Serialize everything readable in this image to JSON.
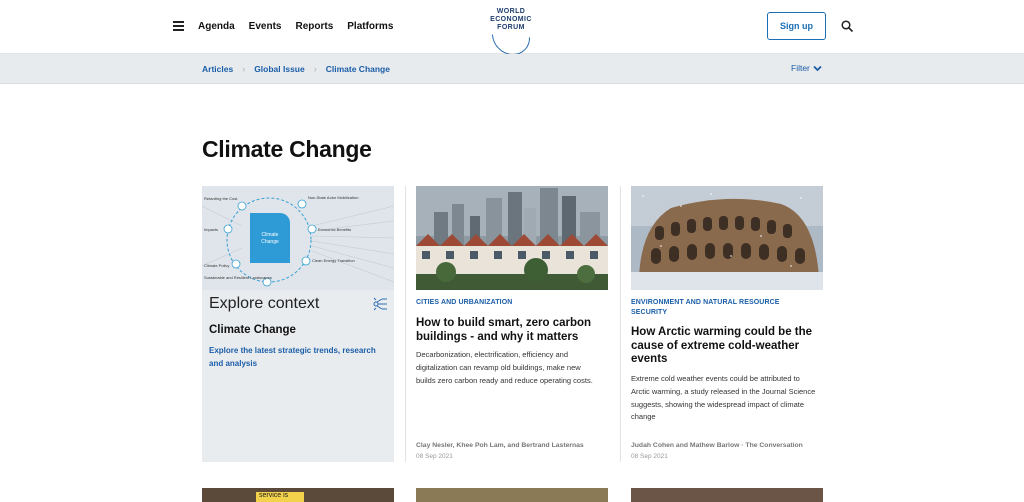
{
  "header": {
    "nav": [
      "Agenda",
      "Events",
      "Reports",
      "Platforms"
    ],
    "logo_lines": [
      "WORLD",
      "ECONOMIC",
      "FORUM"
    ],
    "signup_label": "Sign up"
  },
  "breadcrumb": {
    "items": [
      "Articles",
      "Global Issue",
      "Climate Change"
    ],
    "filter_label": "Filter"
  },
  "page": {
    "title": "Climate Change"
  },
  "context_card": {
    "explore_label": "Explore context",
    "heading": "Climate Change",
    "link": "Explore the latest strategic trends, research and analysis",
    "diagram": {
      "center": [
        "Climate",
        "Change"
      ],
      "nodes": [
        "Retarding the Cost",
        "Non-State Actor Mobilization",
        "Impacts",
        "Economic Benefits",
        "Climate Policy",
        "Clean Energy Transition",
        "Sustainable and Resilient Landscapes"
      ]
    }
  },
  "articles": [
    {
      "kicker": "CITIES AND URBANIZATION",
      "title": "How to build smart, zero carbon buildings - and why it matters",
      "description": "Decarbonization, electrification, efficiency and digitalization can revamp old buildings, make new builds zero carbon ready and reduce operating costs.",
      "byline": "Clay Nesler, Khee Poh Lam, and Bertrand Lasternas",
      "date": "08 Sep 2021"
    },
    {
      "kicker": "ENVIRONMENT AND NATURAL RESOURCE SECURITY",
      "title": "How Arctic warming could be the cause of extreme cold-weather events",
      "description": "Extreme cold weather events could be attributed to Arctic warming, a study released in the Journal Science suggests, showing the widespread impact of climate change",
      "byline": "Judah Cohen and Mathew Barlow · The Conversation",
      "date": "08 Sep 2021"
    }
  ],
  "bottom_thumb_text": "service is"
}
